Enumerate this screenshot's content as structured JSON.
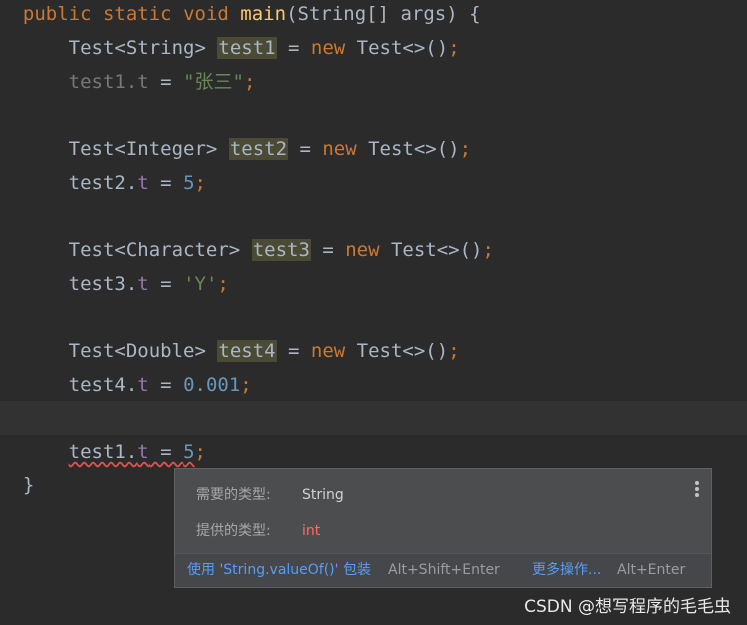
{
  "code": {
    "kw_public": "public",
    "kw_static": "static",
    "kw_void": "void",
    "fn_main": "main",
    "main_params": "(String[] args) {",
    "l1_type": "Test<String>",
    "l1_var": "test1",
    "l1_eq": " = ",
    "kw_new": "new",
    "l1_ctor": " Test<>()",
    "semi": ";",
    "l2_obj": "test1.",
    "l2_field": "t",
    "l2_eq": " = ",
    "l2_str": "\"张三\"",
    "l3_type": "Test<Integer>",
    "l3_var": "test2",
    "l3_ctor": " Test<>()",
    "l4_obj": "test2.",
    "l4_field": "t",
    "l4_num": "5",
    "l5_type": "Test<Character>",
    "l5_var": "test3",
    "l5_ctor": " Test<>()",
    "l6_obj": "test3.",
    "l6_field": "t",
    "l6_chr": "'Y'",
    "l7_type": "Test<Double>",
    "l7_var": "test4",
    "l7_ctor": " Test<>()",
    "l8_obj": "test4.",
    "l8_field": "t",
    "l8_num": "0.001",
    "l9_obj": "test1.",
    "l9_field": "t",
    "l9_num": "5",
    "close_brace": "}"
  },
  "popup": {
    "required_label": "需要的类型:",
    "required_value": "String",
    "provided_label": "提供的类型:",
    "provided_value": "int",
    "fix_action": "使用 'String.valueOf()' 包装",
    "fix_shortcut": "Alt+Shift+Enter",
    "more_actions": "更多操作...",
    "more_shortcut": "Alt+Enter"
  },
  "watermark": "CSDN @想写程序的毛毛虫",
  "colors": {
    "keyword": "#cc7832",
    "function": "#ffc66d",
    "field": "#9876aa",
    "number": "#6897bb",
    "string": "#6a8759",
    "error": "#ff6b68",
    "link": "#589df6"
  }
}
